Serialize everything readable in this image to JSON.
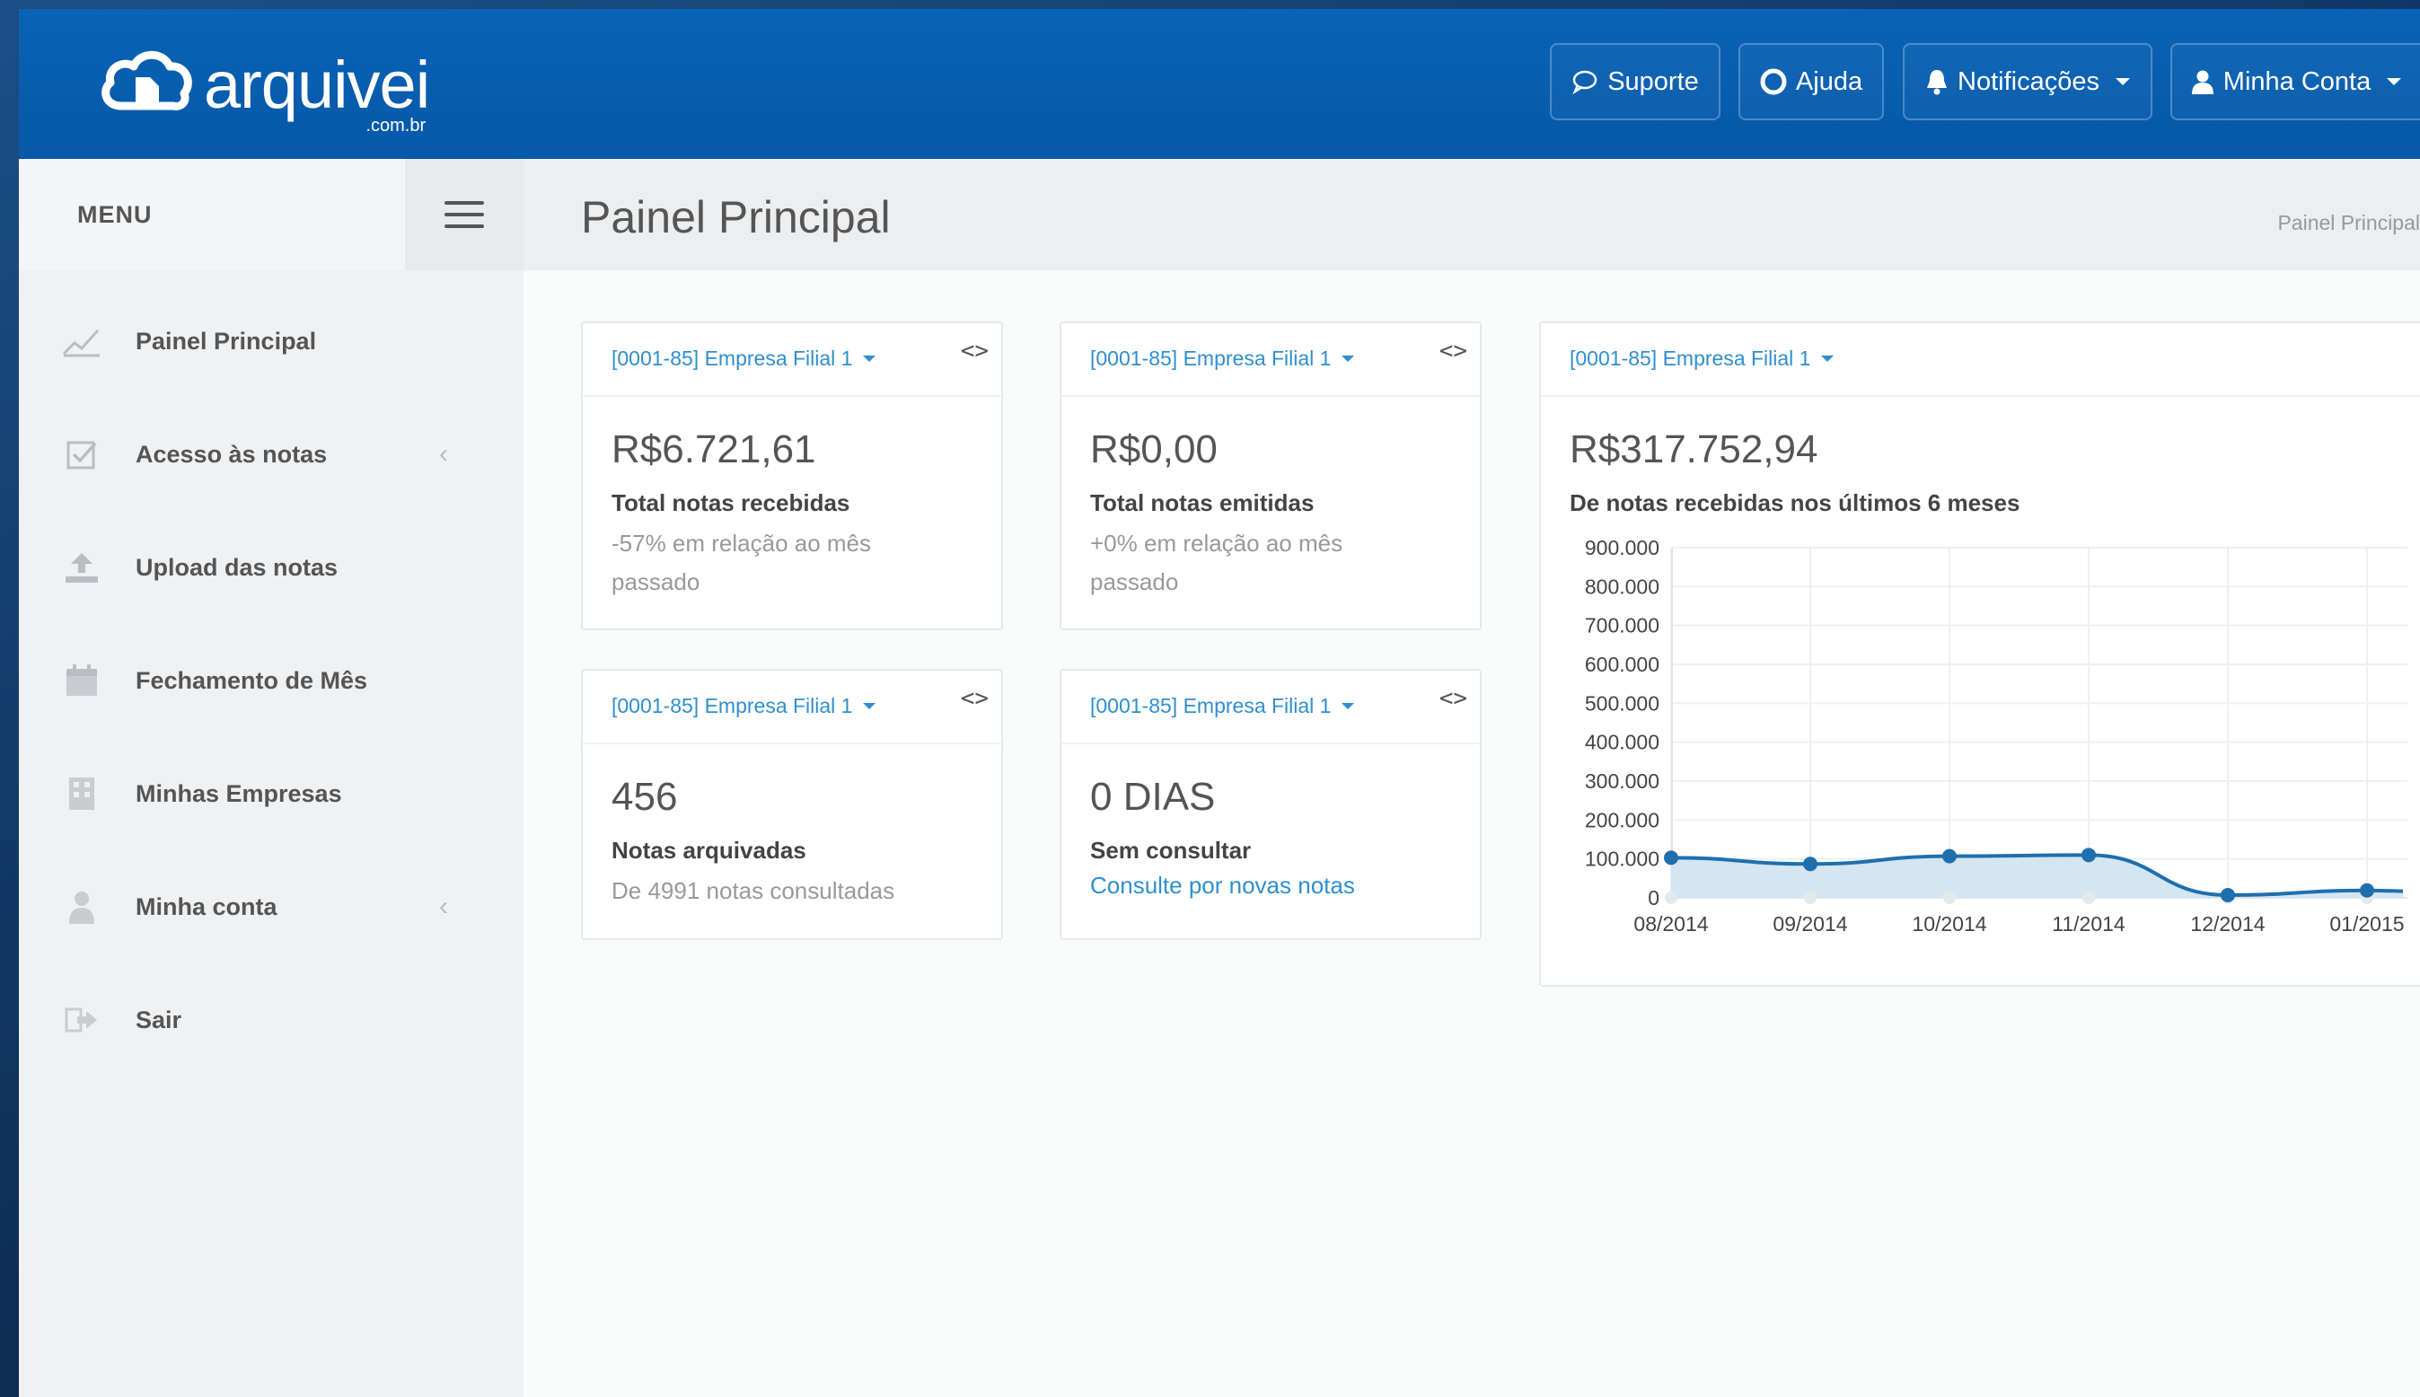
{
  "header": {
    "logo_text": "arquivei",
    "logo_domain": ".com.br",
    "support": "Suporte",
    "help": "Ajuda",
    "notifications": "Notificações",
    "account": "Minha Conta"
  },
  "sidebar": {
    "menu_label": "MENU",
    "items": [
      {
        "label": "Painel Principal",
        "icon": "chart-line-icon"
      },
      {
        "label": "Acesso às notas",
        "icon": "checkbox-icon"
      },
      {
        "label": "Upload das notas",
        "icon": "upload-icon"
      },
      {
        "label": "Fechamento de Mês",
        "icon": "calendar-icon"
      },
      {
        "label": "Minhas Empresas",
        "icon": "building-icon"
      },
      {
        "label": "Minha conta",
        "icon": "user-icon"
      },
      {
        "label": "Sair",
        "icon": "sign-out-icon"
      }
    ]
  },
  "page": {
    "title": "Painel Principal",
    "breadcrumb": "Painel Principal"
  },
  "cards": [
    {
      "company": "[0001-85] Empresa Filial 1",
      "value": "R$6.721,61",
      "label": "Total notas recebidas",
      "desc": "-57% em relação ao mês passado"
    },
    {
      "company": "[0001-85] Empresa Filial 1",
      "value": "R$0,00",
      "label": "Total notas emitidas",
      "desc": "+0% em relação ao mês passado"
    },
    {
      "company": "[0001-85] Empresa Filial 1",
      "value": "456",
      "label": "Notas arquivadas",
      "desc": "De 4991 notas consultadas"
    },
    {
      "company": "[0001-85] Empresa Filial 1",
      "value": "0 DIAS",
      "label": "Sem consultar",
      "link": "Consulte por novas notas"
    }
  ],
  "chart_card": {
    "company": "[0001-85] Empresa Filial 1",
    "value": "R$317.752,94",
    "label": "De notas recebidas nos últimos 6 meses",
    "code_symbol": "<>"
  },
  "colors": {
    "header": "#0a63b6",
    "accent": "#2f8fce",
    "series_line": "#1f6fae",
    "series_fill": "#cfe3f1"
  },
  "chart_data": {
    "type": "area",
    "x": [
      "08/2014",
      "09/2014",
      "10/2014",
      "11/2014",
      "12/2014",
      "01/2015"
    ],
    "y_tick_labels": [
      "900.000",
      "800.000",
      "700.000",
      "600.000",
      "500.000",
      "400.000",
      "300.000",
      "200.000",
      "100.000",
      "0"
    ],
    "ylim": [
      0,
      900000
    ],
    "grid": true,
    "series": [
      {
        "values": [
          103000,
          87000,
          107000,
          110000,
          7000,
          19000
        ]
      }
    ]
  }
}
